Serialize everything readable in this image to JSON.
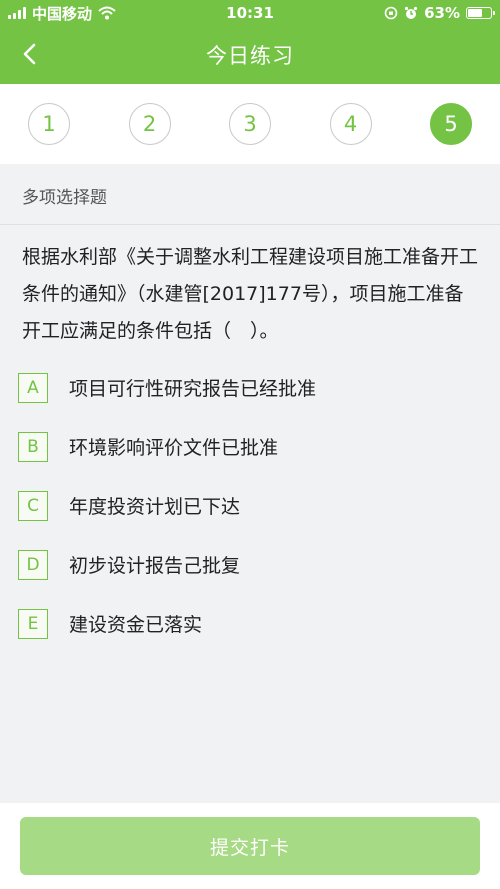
{
  "status_bar": {
    "carrier": "中国移动",
    "time": "10:31",
    "battery": "63%",
    "battery_level": 0.63
  },
  "header": {
    "title": "今日练习"
  },
  "steps": [
    "1",
    "2",
    "3",
    "4",
    "5"
  ],
  "question": {
    "type": "多项选择题",
    "text": "根据水利部《关于调整水利工程建设项目施工准备开工条件的通知》（水建管[2017]177号），项目施工准备开工应满足的条件包括（　）。",
    "options": [
      {
        "letter": "A",
        "text": "项目可行性研究报告已经批准"
      },
      {
        "letter": "B",
        "text": "环境影响评价文件已批准"
      },
      {
        "letter": "C",
        "text": "年度投资计划已下达"
      },
      {
        "letter": "D",
        "text": "初步设计报告己批复"
      },
      {
        "letter": "E",
        "text": "建设资金已落实"
      }
    ]
  },
  "footer": {
    "submit_label": "提交打卡"
  },
  "colors": {
    "brand": "#74c345",
    "submit": "#a7da85",
    "background": "#f1f2f4"
  }
}
